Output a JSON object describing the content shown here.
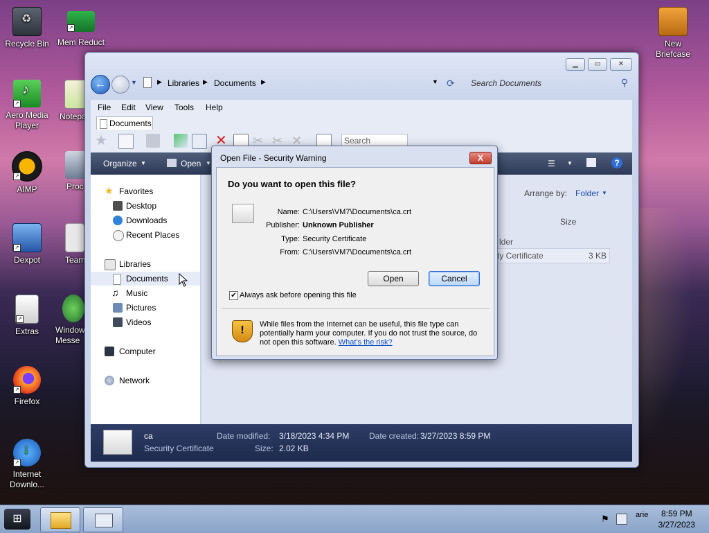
{
  "desktop": {
    "icons": [
      {
        "label": "Recycle Bin"
      },
      {
        "label": "Mem Reduct"
      },
      {
        "label": "New Briefcase"
      },
      {
        "label": "Aero Media Player"
      },
      {
        "label": "Notepa"
      },
      {
        "label": "AIMP"
      },
      {
        "label": "Proc Hack"
      },
      {
        "label": "Dexpot"
      },
      {
        "label": "Team"
      },
      {
        "label": "Extras"
      },
      {
        "label": "Window Messe"
      },
      {
        "label": "Firefox"
      },
      {
        "label": "Internet Downlo..."
      }
    ]
  },
  "explorer": {
    "breadcrumb": [
      "Libraries",
      "Documents"
    ],
    "search_placeholder": "Search Documents",
    "menu": [
      "File",
      "Edit",
      "View",
      "Tools",
      "Help"
    ],
    "tab_label": "Documents",
    "toolbar_search_placeholder": "Search",
    "commands": {
      "organize": "Organize",
      "open": "Open"
    },
    "arrange_by_label": "Arrange by:",
    "arrange_by_value": "Folder",
    "column_size": "Size",
    "partial_row": {
      "folder": "lder",
      "type": "ty Certificate",
      "size": "3 KB"
    },
    "nav": {
      "favorites": "Favorites",
      "desktop": "Desktop",
      "downloads": "Downloads",
      "recent": "Recent Places",
      "libraries": "Libraries",
      "documents": "Documents",
      "music": "Music",
      "pictures": "Pictures",
      "videos": "Videos",
      "computer": "Computer",
      "network": "Network"
    },
    "details": {
      "name": "ca",
      "type": "Security Certificate",
      "modified_label": "Date modified:",
      "modified_value": "3/18/2023 4:34 PM",
      "created_label": "Date created:",
      "created_value": "3/27/2023 8:59 PM",
      "size_label": "Size:",
      "size_value": "2.02 KB"
    }
  },
  "dialog": {
    "title": "Open File - Security Warning",
    "close": "X",
    "question": "Do you want to open this file?",
    "fields": [
      {
        "label": "Name:",
        "value": "C:\\Users\\VM7\\Documents\\ca.crt"
      },
      {
        "label": "Publisher:",
        "value": "Unknown Publisher"
      },
      {
        "label": "Type:",
        "value": "Security Certificate"
      },
      {
        "label": "From:",
        "value": "C:\\Users\\VM7\\Documents\\ca.crt"
      }
    ],
    "open_button": "Open",
    "cancel_button": "Cancel",
    "checkbox_label": "Always ask before opening this file",
    "checkbox_checked": true,
    "warning_text": "While files from the Internet can be useful, this file type can potentially harm your computer. If you do not trust the source, do not open this software.",
    "risk_link": "What's the risk?"
  },
  "taskbar": {
    "time": "8:59 PM",
    "date": "3/27/2023",
    "tray_partial": "arie"
  }
}
